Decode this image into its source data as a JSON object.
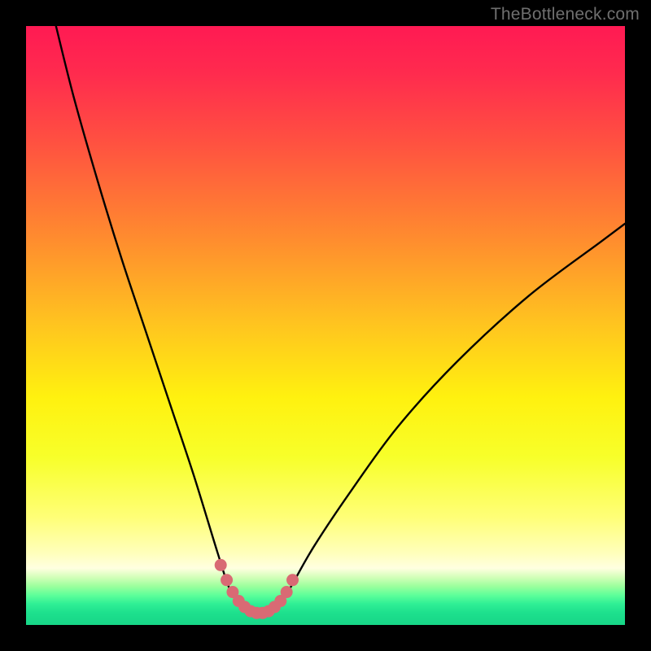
{
  "watermark": "TheBottleneck.com",
  "colors": {
    "frame": "#000000",
    "curve": "#000000",
    "highlight": "#d96a74",
    "gradient_stops": [
      {
        "offset": 0.0,
        "color": "#ff1a53"
      },
      {
        "offset": 0.08,
        "color": "#ff2b4e"
      },
      {
        "offset": 0.2,
        "color": "#ff5340"
      },
      {
        "offset": 0.35,
        "color": "#ff8a2f"
      },
      {
        "offset": 0.5,
        "color": "#ffc51f"
      },
      {
        "offset": 0.62,
        "color": "#fff10f"
      },
      {
        "offset": 0.72,
        "color": "#f7ff2a"
      },
      {
        "offset": 0.82,
        "color": "#ffff77"
      },
      {
        "offset": 0.88,
        "color": "#ffffbb"
      },
      {
        "offset": 0.905,
        "color": "#ffffe0"
      },
      {
        "offset": 0.92,
        "color": "#d4ffba"
      },
      {
        "offset": 0.935,
        "color": "#9dff9d"
      },
      {
        "offset": 0.95,
        "color": "#5fff9a"
      },
      {
        "offset": 0.965,
        "color": "#2fef95"
      },
      {
        "offset": 0.98,
        "color": "#1de08d"
      },
      {
        "offset": 1.0,
        "color": "#17d687"
      }
    ]
  },
  "chart_data": {
    "type": "line",
    "title": "",
    "xlabel": "",
    "ylabel": "",
    "xlim": [
      0,
      100
    ],
    "ylim": [
      0,
      100
    ],
    "grid": false,
    "legend": false,
    "optimal_range_x": [
      34,
      44
    ],
    "series": [
      {
        "name": "bottleneck_curve",
        "x": [
          5,
          8,
          12,
          16,
          20,
          24,
          28,
          32,
          34,
          36,
          38,
          40,
          42,
          44,
          48,
          54,
          62,
          72,
          84,
          96,
          100
        ],
        "y": [
          100,
          88,
          74,
          61,
          49,
          37,
          25,
          12,
          6,
          3,
          2,
          2,
          3,
          6,
          13,
          22,
          33,
          44,
          55,
          64,
          67
        ]
      }
    ],
    "highlighted_points": {
      "name": "optimal_region_markers",
      "x": [
        32.5,
        33.5,
        34.5,
        35.5,
        36.5,
        37.5,
        38.5,
        39.5,
        40.5,
        41.5,
        42.5,
        43.5,
        44.5
      ],
      "y": [
        10.0,
        7.5,
        5.5,
        4.0,
        3.0,
        2.3,
        2.0,
        2.0,
        2.3,
        3.0,
        4.0,
        5.5,
        7.5
      ]
    }
  }
}
